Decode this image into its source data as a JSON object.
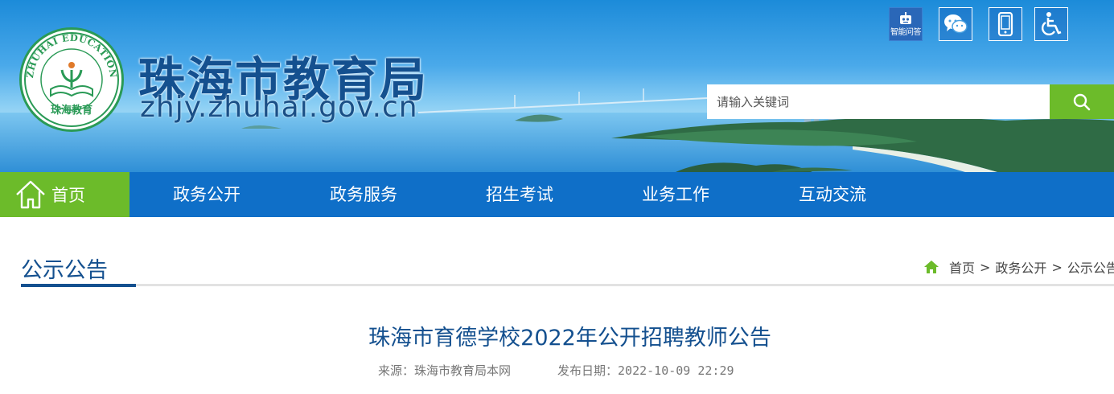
{
  "site": {
    "title": "珠海市教育局",
    "domain": "zhjy.zhuhai.gov.cn",
    "logo_ring_text": "ZHUHAI EDUCATION",
    "logo_bottom_text": "珠海教育"
  },
  "top_icons": {
    "robot_label": "智能问答"
  },
  "search": {
    "placeholder": "请输入关键词"
  },
  "nav": {
    "home": "首页",
    "items": [
      "政务公开",
      "政务服务",
      "招生考试",
      "业务工作",
      "互动交流"
    ]
  },
  "section": {
    "title": "公示公告"
  },
  "breadcrumb": {
    "items": [
      "首页",
      "政务公开",
      "公示公告"
    ],
    "separator": ">"
  },
  "article": {
    "title": "珠海市育德学校2022年公开招聘教师公告",
    "source": "来源：珠海市教育局本网",
    "date": "发布日期：2022-10-09 22:29"
  },
  "colors": {
    "primary_blue": "#0f6fc8",
    "accent_green": "#6cbb2a",
    "title_blue": "#14508f"
  }
}
